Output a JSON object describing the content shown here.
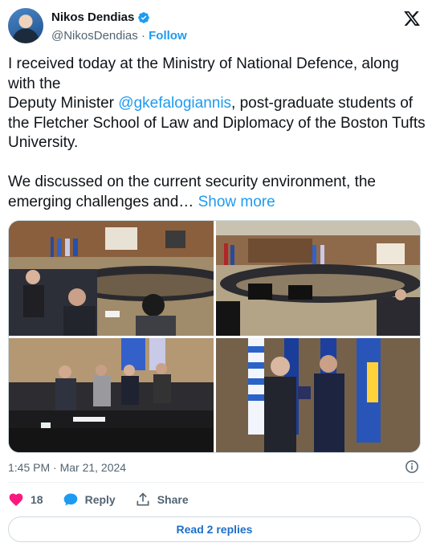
{
  "author": {
    "name": "Nikos Dendias",
    "handle": "@NikosDendias",
    "separator": "·",
    "follow_label": "Follow"
  },
  "tweet": {
    "line1": "I received today at the Ministry of National Defence, along with the",
    "line2_before": "Deputy Minister ",
    "mention": "@gkefalogiannis",
    "line2_after": ", post-graduate students of the Fletcher School of Law and Diplomacy of the Boston Tufts University.",
    "para2": "We discussed on the current security environment, the emerging challenges and…",
    "show_more": "Show more"
  },
  "meta": {
    "timestamp": "1:45 PM · Mar 21, 2024"
  },
  "actions": {
    "likes_count": "18",
    "reply_label": "Reply",
    "share_label": "Share"
  },
  "read_replies": "Read 2 replies",
  "colors": {
    "accent": "#1d9bf0",
    "like": "#f91880",
    "text": "#0f1419",
    "muted": "#536471"
  },
  "icons": [
    "verified-badge-icon",
    "x-logo-icon",
    "info-icon",
    "heart-icon",
    "reply-bubble-icon",
    "share-icon"
  ]
}
